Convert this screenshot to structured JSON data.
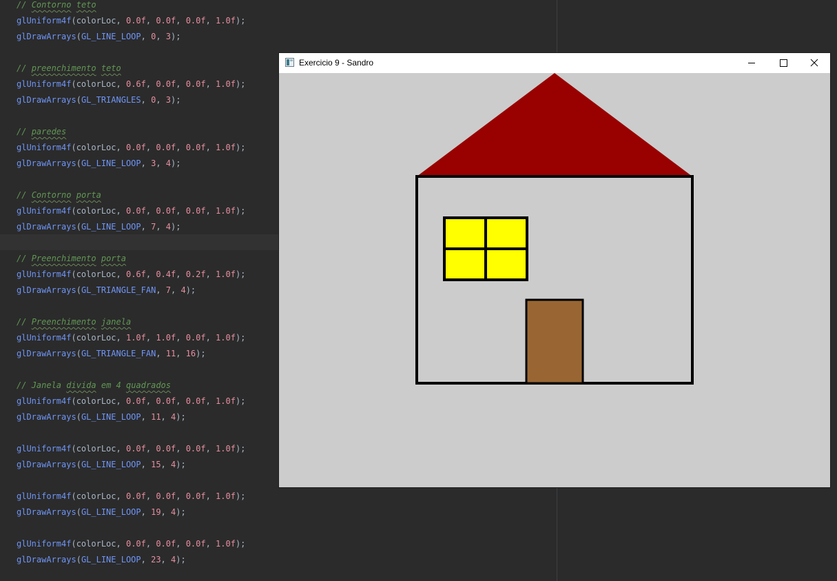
{
  "code": {
    "lines": [
      {
        "kind": "comment",
        "prefix": "// ",
        "words": [
          {
            "t": "Contorno",
            "sq": true
          },
          {
            "t": " "
          },
          {
            "t": "teto",
            "sq": true
          }
        ]
      },
      {
        "kind": "uniform",
        "fn": "glUniform4f",
        "var": "colorLoc",
        "args": [
          "0.0f",
          "0.0f",
          "0.0f",
          "1.0f"
        ]
      },
      {
        "kind": "draw",
        "fn": "glDrawArrays",
        "mode": "GL_LINE_LOOP",
        "args": [
          "0",
          "3"
        ]
      },
      {
        "kind": "blank"
      },
      {
        "kind": "comment",
        "prefix": "// ",
        "words": [
          {
            "t": "preenchimento",
            "sq": true
          },
          {
            "t": " "
          },
          {
            "t": "teto",
            "sq": true
          }
        ]
      },
      {
        "kind": "uniform",
        "fn": "glUniform4f",
        "var": "colorLoc",
        "args": [
          "0.6f",
          "0.0f",
          "0.0f",
          "1.0f"
        ]
      },
      {
        "kind": "draw",
        "fn": "glDrawArrays",
        "mode": "GL_TRIANGLES",
        "args": [
          "0",
          "3"
        ]
      },
      {
        "kind": "blank"
      },
      {
        "kind": "comment",
        "prefix": "// ",
        "words": [
          {
            "t": "paredes",
            "sq": true
          }
        ]
      },
      {
        "kind": "uniform",
        "fn": "glUniform4f",
        "var": "colorLoc",
        "args": [
          "0.0f",
          "0.0f",
          "0.0f",
          "1.0f"
        ]
      },
      {
        "kind": "draw",
        "fn": "glDrawArrays",
        "mode": "GL_LINE_LOOP",
        "args": [
          "3",
          "4"
        ]
      },
      {
        "kind": "blank"
      },
      {
        "kind": "comment",
        "prefix": "// ",
        "words": [
          {
            "t": "Contorno",
            "sq": true
          },
          {
            "t": " "
          },
          {
            "t": "porta",
            "sq": true
          }
        ]
      },
      {
        "kind": "uniform",
        "fn": "glUniform4f",
        "var": "colorLoc",
        "args": [
          "0.0f",
          "0.0f",
          "0.0f",
          "1.0f"
        ]
      },
      {
        "kind": "draw",
        "fn": "glDrawArrays",
        "mode": "GL_LINE_LOOP",
        "args": [
          "7",
          "4"
        ]
      },
      {
        "kind": "blank"
      },
      {
        "kind": "comment",
        "prefix": "// ",
        "words": [
          {
            "t": "Preenchimento",
            "sq": true
          },
          {
            "t": " "
          },
          {
            "t": "porta",
            "sq": true
          }
        ]
      },
      {
        "kind": "uniform",
        "fn": "glUniform4f",
        "var": "colorLoc",
        "args": [
          "0.6f",
          "0.4f",
          "0.2f",
          "1.0f"
        ]
      },
      {
        "kind": "draw",
        "fn": "glDrawArrays",
        "mode": "GL_TRIANGLE_FAN",
        "args": [
          "7",
          "4"
        ]
      },
      {
        "kind": "blank"
      },
      {
        "kind": "comment",
        "prefix": "// ",
        "words": [
          {
            "t": "Preenchimento",
            "sq": true
          },
          {
            "t": " "
          },
          {
            "t": "janela",
            "sq": true
          }
        ]
      },
      {
        "kind": "uniform",
        "fn": "glUniform4f",
        "var": "colorLoc",
        "args": [
          "1.0f",
          "1.0f",
          "0.0f",
          "1.0f"
        ]
      },
      {
        "kind": "draw",
        "fn": "glDrawArrays",
        "mode": "GL_TRIANGLE_FAN",
        "args": [
          "11",
          "16"
        ]
      },
      {
        "kind": "blank"
      },
      {
        "kind": "comment",
        "prefix": "// ",
        "words": [
          {
            "t": "Janela "
          },
          {
            "t": "divida",
            "sq": true
          },
          {
            "t": " em 4 "
          },
          {
            "t": "quadrados",
            "sq": true
          }
        ]
      },
      {
        "kind": "uniform",
        "fn": "glUniform4f",
        "var": "colorLoc",
        "args": [
          "0.0f",
          "0.0f",
          "0.0f",
          "1.0f"
        ]
      },
      {
        "kind": "draw",
        "fn": "glDrawArrays",
        "mode": "GL_LINE_LOOP",
        "args": [
          "11",
          "4"
        ]
      },
      {
        "kind": "blank"
      },
      {
        "kind": "uniform",
        "fn": "glUniform4f",
        "var": "colorLoc",
        "args": [
          "0.0f",
          "0.0f",
          "0.0f",
          "1.0f"
        ]
      },
      {
        "kind": "draw",
        "fn": "glDrawArrays",
        "mode": "GL_LINE_LOOP",
        "args": [
          "15",
          "4"
        ]
      },
      {
        "kind": "blank"
      },
      {
        "kind": "uniform",
        "fn": "glUniform4f",
        "var": "colorLoc",
        "args": [
          "0.0f",
          "0.0f",
          "0.0f",
          "1.0f"
        ]
      },
      {
        "kind": "draw",
        "fn": "glDrawArrays",
        "mode": "GL_LINE_LOOP",
        "args": [
          "19",
          "4"
        ]
      },
      {
        "kind": "blank"
      },
      {
        "kind": "uniform",
        "fn": "glUniform4f",
        "var": "colorLoc",
        "args": [
          "0.0f",
          "0.0f",
          "0.0f",
          "1.0f"
        ]
      },
      {
        "kind": "draw",
        "fn": "glDrawArrays",
        "mode": "GL_LINE_LOOP",
        "args": [
          "23",
          "4"
        ]
      }
    ]
  },
  "window": {
    "title": "Exercicio 9 - Sandro",
    "icon": "app-window-icon",
    "controls": [
      "minimize-icon",
      "maximize-icon",
      "close-icon"
    ],
    "background_color": "#cccccc"
  },
  "scene": {
    "roof_color": "#990000",
    "wall_color": "#000000",
    "door_color": "#996633",
    "window_color": "#ffff00",
    "outline_color": "#000000",
    "clear_color": "#cccccc"
  }
}
